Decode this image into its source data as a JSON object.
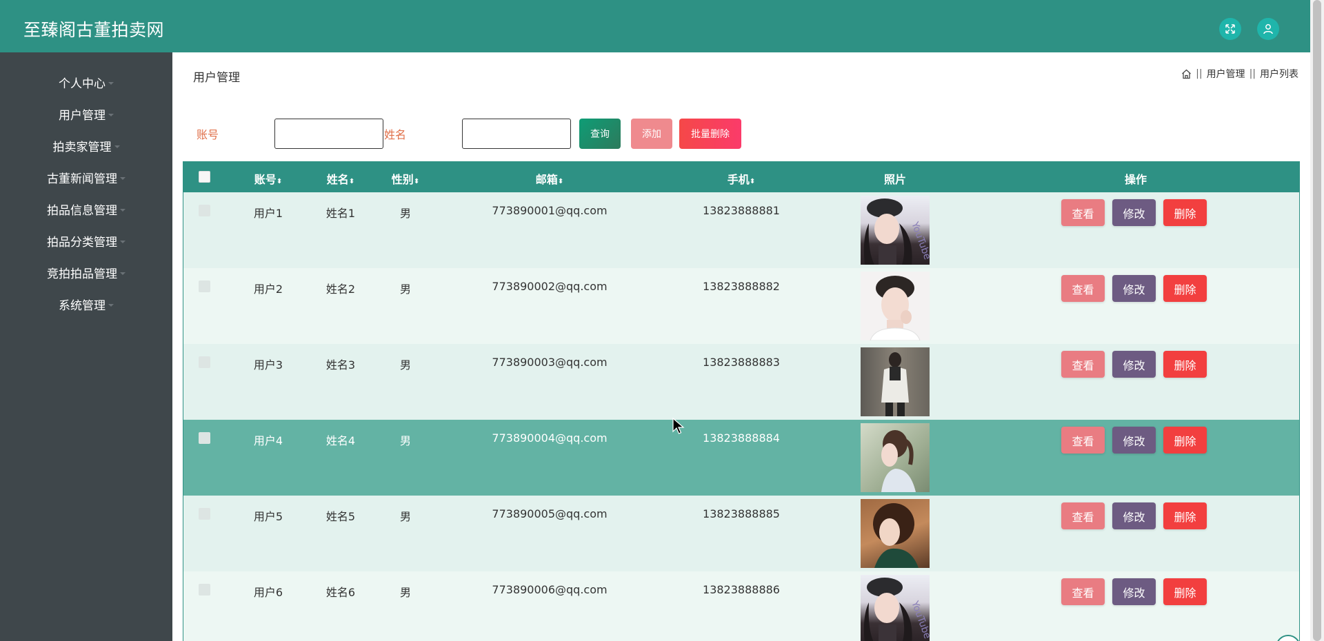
{
  "app": {
    "title": "至臻阁古董拍卖网"
  },
  "sidebar": {
    "items": [
      {
        "label": "个人中心"
      },
      {
        "label": "用户管理"
      },
      {
        "label": "拍卖家管理"
      },
      {
        "label": "古董新闻管理"
      },
      {
        "label": "拍品信息管理"
      },
      {
        "label": "拍品分类管理"
      },
      {
        "label": "竞拍拍品管理"
      },
      {
        "label": "系统管理"
      }
    ]
  },
  "page": {
    "title": "用户管理",
    "breadcrumb": [
      "用户管理",
      "用户列表"
    ]
  },
  "search": {
    "account_label": "账号",
    "account_value": "",
    "name_label": "姓名",
    "name_value": "",
    "query_label": "查询",
    "add_label": "添加",
    "batch_delete_label": "批量删除"
  },
  "table": {
    "headers": {
      "account": "账号",
      "name": "姓名",
      "gender": "性别",
      "email": "邮箱",
      "phone": "手机",
      "photo": "照片",
      "actions": "操作"
    },
    "sort_icon": "⬍",
    "actions": {
      "view": "查看",
      "edit": "修改",
      "delete": "删除"
    },
    "rows": [
      {
        "account": "用户1",
        "name": "姓名1",
        "gender": "男",
        "email": "773890001@qq.com",
        "phone": "13823888881"
      },
      {
        "account": "用户2",
        "name": "姓名2",
        "gender": "男",
        "email": "773890002@qq.com",
        "phone": "13823888882"
      },
      {
        "account": "用户3",
        "name": "姓名3",
        "gender": "男",
        "email": "773890003@qq.com",
        "phone": "13823888883"
      },
      {
        "account": "用户4",
        "name": "姓名4",
        "gender": "男",
        "email": "773890004@qq.com",
        "phone": "13823888884"
      },
      {
        "account": "用户5",
        "name": "姓名5",
        "gender": "男",
        "email": "773890005@qq.com",
        "phone": "13823888885"
      },
      {
        "account": "用户6",
        "name": "姓名6",
        "gender": "男",
        "email": "773890006@qq.com",
        "phone": "13823888886"
      }
    ]
  },
  "icons": {
    "fullscreen": "fullscreen-icon",
    "user": "user-icon",
    "home": "home-icon",
    "sort": "sort-icon",
    "menu_caret": "caret-down-icon",
    "cursor": "mouse-cursor-icon"
  },
  "colors": {
    "primary": "#2e9184",
    "sidebar": "#3f474b",
    "row_highlight": "#63b3a4",
    "view_button": "#e97c82",
    "edit_button": "#6d5b82",
    "delete_button": "#f23f3f",
    "label_accent": "#e0704a"
  }
}
